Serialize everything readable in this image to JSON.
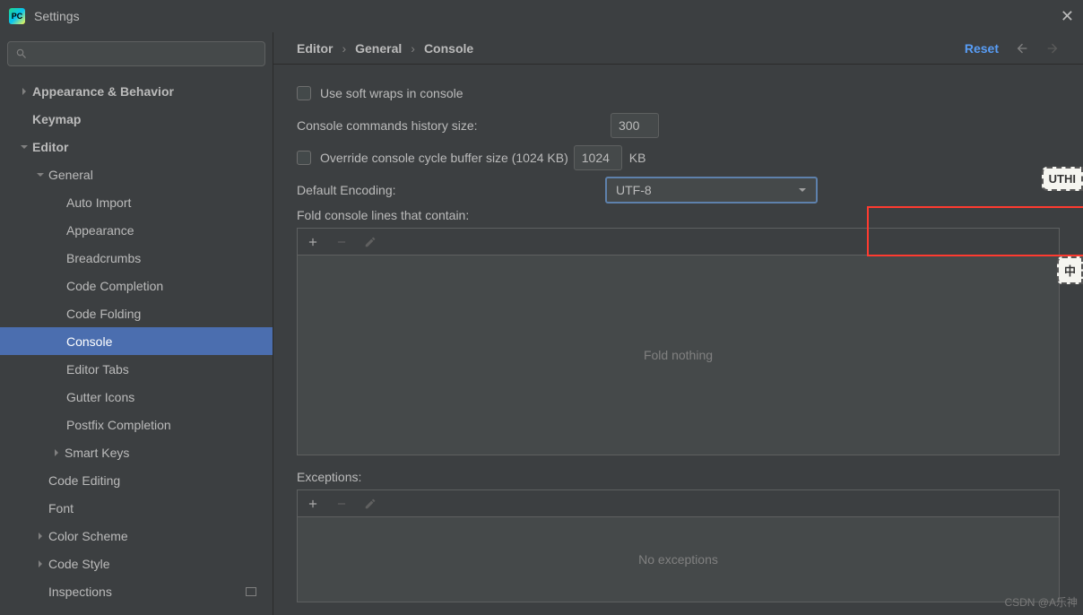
{
  "window": {
    "title": "Settings"
  },
  "sidebar": {
    "search_placeholder": "",
    "items": {
      "appearance_behavior": "Appearance & Behavior",
      "keymap": "Keymap",
      "editor": "Editor",
      "general": "General",
      "auto_import": "Auto Import",
      "appearance": "Appearance",
      "breadcrumbs": "Breadcrumbs",
      "code_completion": "Code Completion",
      "code_folding": "Code Folding",
      "console": "Console",
      "editor_tabs": "Editor Tabs",
      "gutter_icons": "Gutter Icons",
      "postfix_completion": "Postfix Completion",
      "smart_keys": "Smart Keys",
      "code_editing": "Code Editing",
      "font": "Font",
      "color_scheme": "Color Scheme",
      "code_style": "Code Style",
      "inspections": "Inspections"
    }
  },
  "breadcrumb": {
    "p0": "Editor",
    "p1": "General",
    "p2": "Console"
  },
  "header": {
    "reset": "Reset"
  },
  "form": {
    "soft_wraps": "Use soft wraps in console",
    "history_label": "Console commands history size:",
    "history_value": "300",
    "override_label": "Override console cycle buffer size (1024 KB)",
    "override_value": "1024",
    "override_unit": "KB",
    "encoding_label": "Default Encoding:",
    "encoding_value": "UTF-8",
    "fold_label": "Fold console lines that contain:",
    "fold_placeholder": "Fold nothing",
    "exceptions_label": "Exceptions:",
    "exceptions_placeholder": "No exceptions"
  },
  "badges": {
    "b1": "UTHI",
    "b2": "中"
  },
  "watermark": "CSDN @A乐神"
}
